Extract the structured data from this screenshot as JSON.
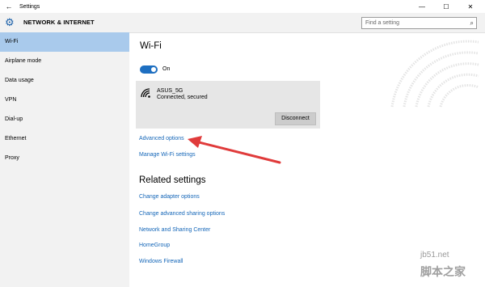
{
  "window": {
    "title": "Settings",
    "back_glyph": "←",
    "minimize_glyph": "—",
    "maximize_glyph": "☐",
    "close_glyph": "✕"
  },
  "header": {
    "section_title": "NETWORK & INTERNET",
    "search_placeholder": "Find a setting",
    "icon": "gear-icon"
  },
  "sidebar": {
    "items": [
      {
        "label": "Wi-Fi",
        "selected": true
      },
      {
        "label": "Airplane mode",
        "selected": false
      },
      {
        "label": "Data usage",
        "selected": false
      },
      {
        "label": "VPN",
        "selected": false
      },
      {
        "label": "Dial-up",
        "selected": false
      },
      {
        "label": "Ethernet",
        "selected": false
      },
      {
        "label": "Proxy",
        "selected": false
      }
    ]
  },
  "main": {
    "title": "Wi-Fi",
    "toggle": {
      "label": "On",
      "state": true
    },
    "network": {
      "ssid": "ASUS_5G",
      "status": "Connected, secured",
      "disconnect_label": "Disconnect"
    },
    "links": {
      "advanced_options": "Advanced options",
      "manage_wifi": "Manage Wi-Fi settings"
    },
    "related": {
      "title": "Related settings",
      "links": [
        "Change adapter options",
        "Change advanced sharing options",
        "Network and Sharing Center",
        "HomeGroup",
        "Windows Firewall"
      ]
    }
  },
  "watermark": {
    "line1": "jb51.net",
    "line2": "脚本之家"
  },
  "colors": {
    "accent": "#1e6fc1",
    "link": "#1466b8",
    "sidebar_selected": "#a9caec",
    "arrow": "#e03b3b"
  }
}
